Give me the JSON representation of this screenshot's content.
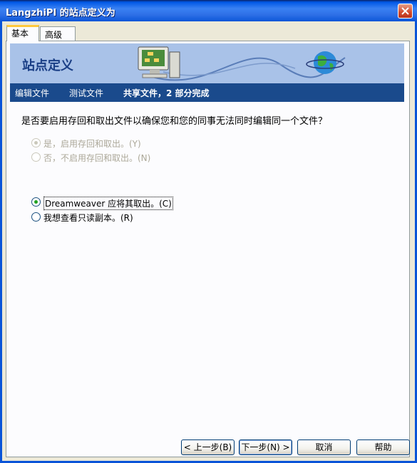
{
  "window": {
    "title": "LangzhiPI 的站点定义为"
  },
  "tabs": [
    {
      "label": "基本"
    },
    {
      "label": "高级"
    }
  ],
  "banner": {
    "title": "站点定义"
  },
  "breadcrumb": {
    "step1": "编辑文件",
    "step2": "测试文件",
    "step3": "共享文件，2 部分完成"
  },
  "question": "是否要启用存回和取出文件以确保您和您的同事无法同时编辑同一个文件？",
  "enable_group": {
    "yes_label": "是，启用存回和取出。(Y)",
    "no_label": "否，不启用存回和取出。(N)"
  },
  "checkout_group": {
    "option1_label": "Dreamweaver 应将其取出。(C)",
    "option2_label": "我想查看只读副本。(R)"
  },
  "buttons": {
    "back": "< 上一步(B)",
    "next": "下一步(N) >",
    "cancel": "取消",
    "help": "帮助"
  },
  "colors": {
    "titlebar": "#0A54D8",
    "banner": "#A9C2E8",
    "breadcrumb_bar": "#1A4A8C",
    "radio_check": "#21A121"
  }
}
